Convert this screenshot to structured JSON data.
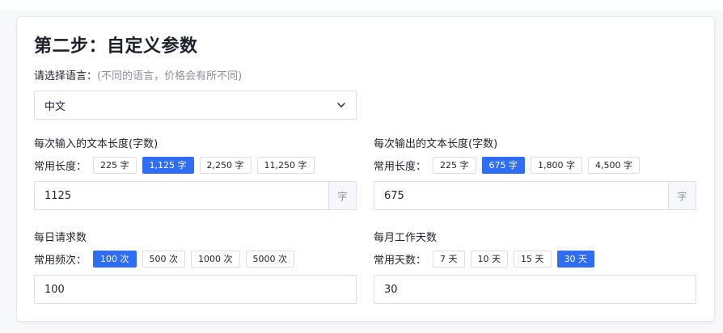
{
  "title": "第二步：自定义参数",
  "language": {
    "label": "请选择语言：",
    "hint": "(不同的语言，价格会有所不同)",
    "selected": "中文"
  },
  "input_length": {
    "label": "每次输入的文本长度(字数)",
    "preset_prefix": "常用长度：",
    "presets": [
      "225 字",
      "1,125 字",
      "2,250 字",
      "11,250 字"
    ],
    "active_index": 1,
    "value": "1125",
    "unit": "字"
  },
  "output_length": {
    "label": "每次输出的文本长度(字数)",
    "preset_prefix": "常用长度：",
    "presets": [
      "225 字",
      "675 字",
      "1,800 字",
      "4,500 字"
    ],
    "active_index": 1,
    "value": "675",
    "unit": "字"
  },
  "daily_requests": {
    "label": "每日请求数",
    "preset_prefix": "常用频次：",
    "presets": [
      "100 次",
      "500 次",
      "1000 次",
      "5000 次"
    ],
    "active_index": 0,
    "value": "100"
  },
  "monthly_days": {
    "label": "每月工作天数",
    "preset_prefix": "常用天数：",
    "presets": [
      "7 天",
      "10 天",
      "15 天",
      "30 天"
    ],
    "active_index": 3,
    "value": "30"
  },
  "colors": {
    "accent": "#2f6df5",
    "border": "#dcdfe6",
    "hint": "#8a8f99"
  }
}
